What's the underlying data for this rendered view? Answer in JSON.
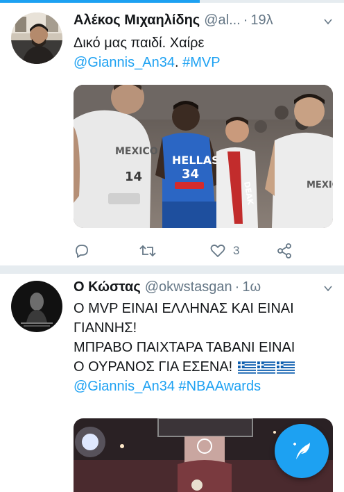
{
  "tweets": [
    {
      "author_name": "Αλέκος Μιχαηλίδης",
      "handle": "@al...",
      "separator": "·",
      "time": "19λ",
      "text_line1": "Δικό μας παιδί. Χαίρε",
      "mention": "@Giannis_An34",
      "text_after_mention": ". ",
      "hashtag": "#MVP",
      "media_jersey_labels": [
        "MEXICO",
        "HELLAS",
        "34",
        "MEXICO",
        "14",
        "DEAK"
      ],
      "actions": {
        "reply_icon": "reply-icon",
        "retweet_icon": "retweet-icon",
        "like_icon": "heart-icon",
        "like_count": "3",
        "share_icon": "share-icon"
      }
    },
    {
      "author_name": "Ο Κώστας",
      "handle": "@okwstasgan",
      "separator": "·",
      "time": "1ω",
      "lines": [
        "Ο MVP ΕΙΝΑΙ ΕΛΛΗΝΑΣ ΚΑΙ ΕΙΝΑΙ",
        "ΓΙΑΝΝΗΣ!",
        "ΜΠΡΑΒΟ ΠΑΙΧΤΑΡΑ ΤΑΒΑΝΙ ΕΙΝΑΙ",
        "Ο ΟΥΡΑΝΟΣ ΓΙΑ ΕΣΕΝΑ!"
      ],
      "flags": [
        "greek-flag",
        "greek-flag",
        "greek-flag"
      ],
      "mention": "@Giannis_An34",
      "hashtag": "#NBAAwards"
    }
  ],
  "compose_button_icon": "compose-tweet-icon",
  "colors": {
    "accent": "#1da1f2",
    "text": "#14171a",
    "muted": "#657786",
    "divider": "#e6ecf0"
  },
  "top_progress": 0.58
}
